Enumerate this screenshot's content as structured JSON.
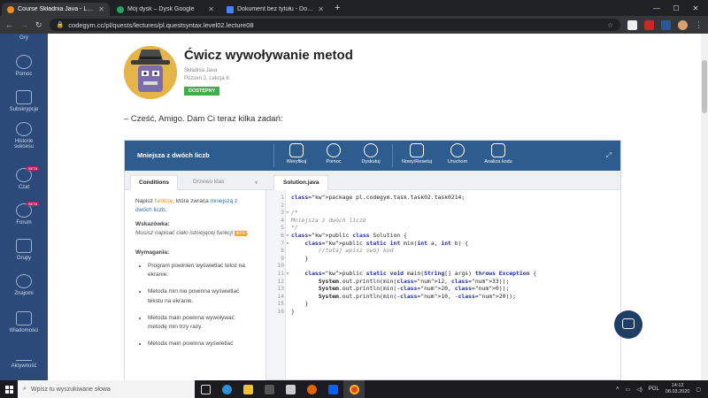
{
  "browser": {
    "tabs": [
      {
        "title": "Course Składnia Java - Lecture: C",
        "favicon_color": "#f08c1b",
        "active": true
      },
      {
        "title": "Mój dysk – Dysk Google",
        "favicon_color": "#1fa463",
        "active": false
      },
      {
        "title": "Dokument bez tytułu - Dokumen",
        "favicon_color": "#4285f4",
        "active": false
      }
    ],
    "new_tab": "+",
    "url": "codegym.cc/pl/quests/lectures/pl.questsyntax.level02.lecture08"
  },
  "sidebar": {
    "items": [
      {
        "label": "Gry",
        "badge": ""
      },
      {
        "label": "Pomoc",
        "badge": ""
      },
      {
        "label": "Subskrypcje",
        "badge": ""
      },
      {
        "label": "Historie sukcesu",
        "badge": ""
      },
      {
        "label": "Czat",
        "badge": "BETA"
      },
      {
        "label": "Forum",
        "badge": "BETA"
      },
      {
        "label": "Grupy",
        "badge": ""
      },
      {
        "label": "Znajomi",
        "badge": ""
      },
      {
        "label": "Wiadomości",
        "badge": ""
      },
      {
        "label": "Aktywność",
        "badge": ""
      }
    ]
  },
  "lesson": {
    "title": "Ćwicz wywoływanie metod",
    "course": "Składnia Java",
    "level": "Poziom 2, Lekcja 8",
    "status": "DOSTĘPNY",
    "greeting": "– Cześć, Amigo. Dam Ci teraz kilka zadań:"
  },
  "task": {
    "title": "Mniejsza z dwóch liczb",
    "tools": [
      "Weryfikuj",
      "Pomoc",
      "Dyskutuj",
      "Nowy/Resetuj",
      "Uruchom",
      "Analiza kodu"
    ],
    "left_tabs": [
      "Conditions",
      "Drzewo klas"
    ],
    "file_tab": "Solution.java",
    "conditions": {
      "intro_prefix": "Napisz ",
      "intro_link1": "funkcję",
      "intro_mid": ", która zwraca ",
      "intro_link2": "mniejszą z dwóch liczb",
      "intro_suffix": ".",
      "hint_heading": "Wskazówka:",
      "hint_text": "Musisz napisać ciało istniejącej funkcji",
      "hint_code": "min",
      "hint_end": ".",
      "requirements_heading": "Wymagania:",
      "requirements": [
        "Program powinien wyświetlać tekst na ekranie.",
        "Metoda min nie powinna wyświetlać tekstu na ekranie.",
        "Metoda main powinna wywoływać metodę min trzy razy.",
        "Metoda main powinna wyświetlać"
      ]
    },
    "code_lines": [
      "package pl.codegym.task.task02.task0214;",
      "",
      "/*",
      "Mniejsza z dwóch liczb",
      "*/",
      "public class Solution {",
      "    public static int min(int a, int b) {",
      "        //tutaj wpisz swój kod",
      "    }",
      "",
      "    public static void main(String[] args) throws Exception {",
      "        System.out.println(min(12, 33));",
      "        System.out.println(min(-20, 0));",
      "        System.out.println(min(-10, -20));",
      "    }",
      "}"
    ]
  },
  "taskbar": {
    "search_placeholder": "Wpisz tu wyszukiwane słowa",
    "lang": "POL",
    "time": "14:12",
    "date": "08.03.2020"
  }
}
